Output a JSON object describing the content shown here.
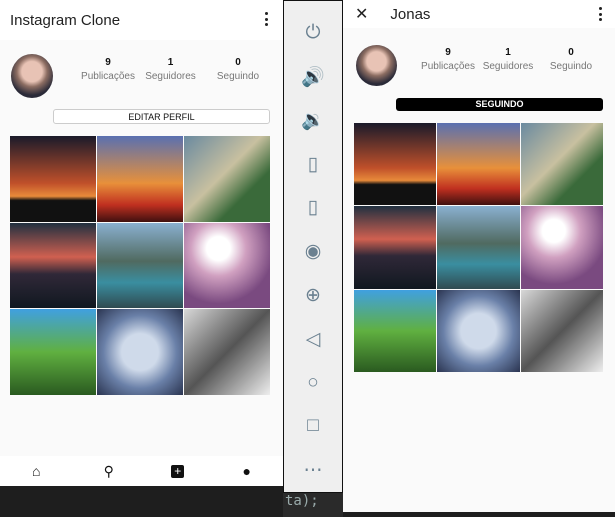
{
  "own_profile": {
    "title": "Instagram Clone",
    "stats": [
      {
        "value": "9",
        "label": "Publicações"
      },
      {
        "value": "1",
        "label": "Seguidores"
      },
      {
        "value": "0",
        "label": "Seguindo"
      }
    ],
    "edit_button": "EDITAR PERFIL",
    "nav": [
      "home-icon",
      "search-icon",
      "add-box-icon",
      "person-icon"
    ]
  },
  "other_profile": {
    "title": "Jonas",
    "stats": [
      {
        "value": "9",
        "label": "Publicações"
      },
      {
        "value": "1",
        "label": "Seguidores"
      },
      {
        "value": "0",
        "label": "Seguindo"
      }
    ],
    "follow_button": "SEGUINDO"
  },
  "emulator_toolbar": [
    "power",
    "volume-up",
    "volume-down",
    "rotate-left",
    "rotate-right",
    "screenshot",
    "zoom",
    "back",
    "home",
    "overview",
    "more"
  ],
  "code_snippet": "ta);"
}
